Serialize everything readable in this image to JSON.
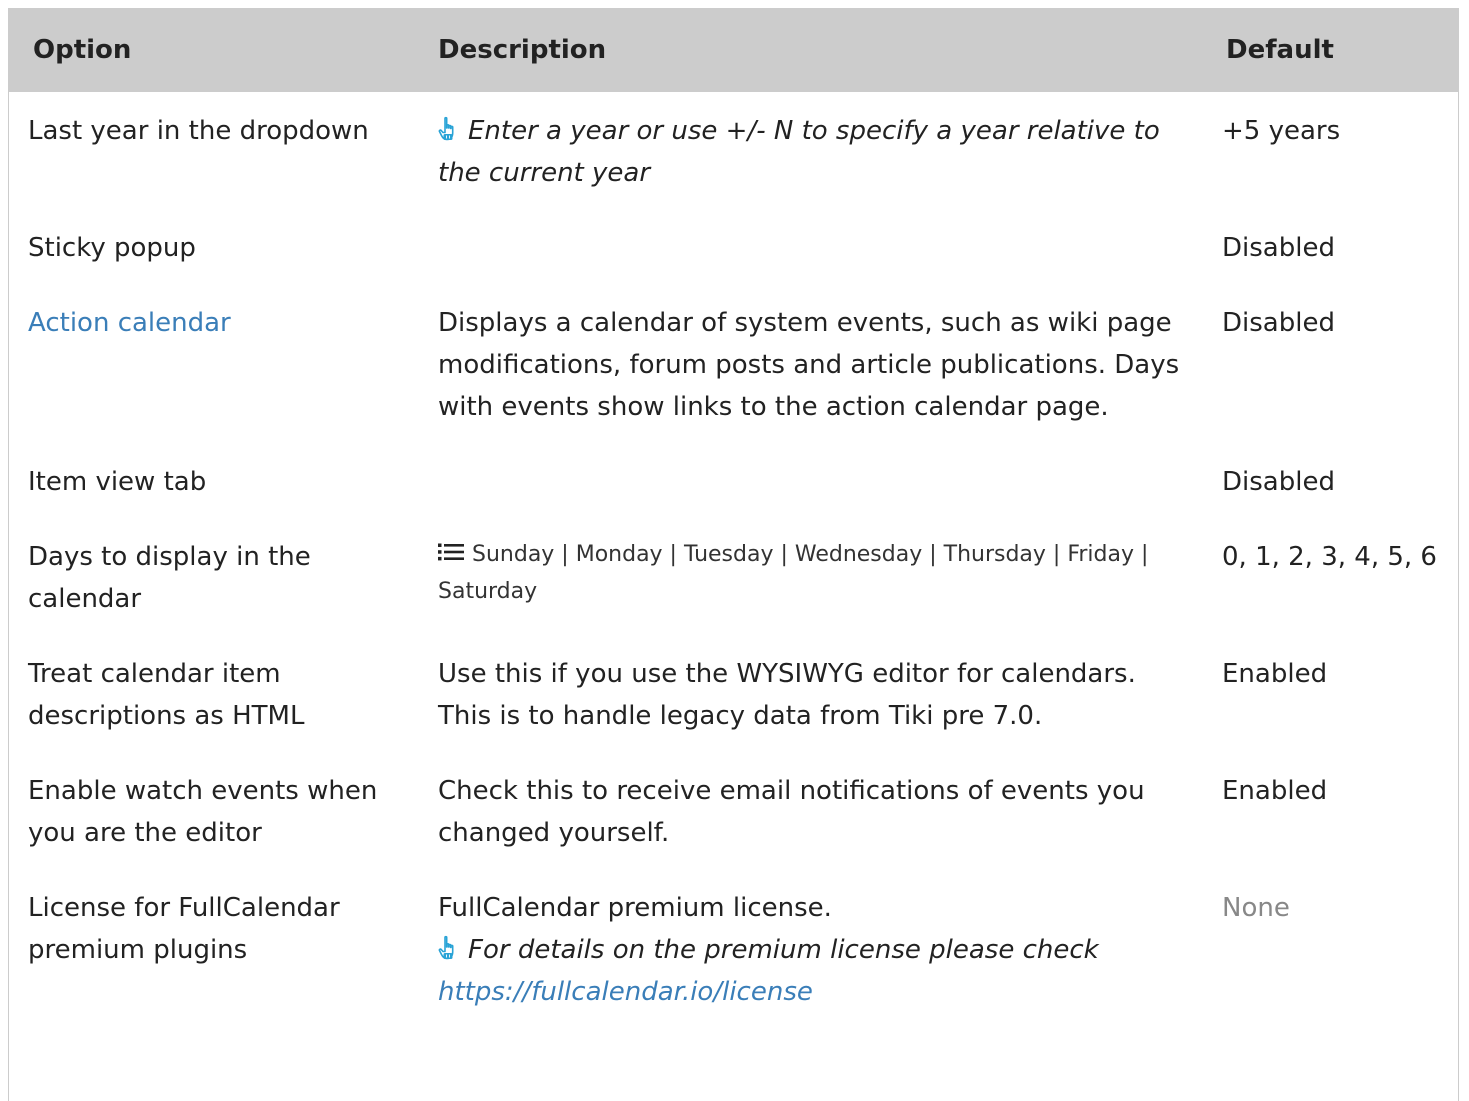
{
  "header": {
    "option": "Option",
    "description": "Description",
    "default": "Default"
  },
  "rows": [
    {
      "option": "Last year in the dropdown",
      "hint": "Enter a year or use +/- N to specify a year relative to the current year",
      "hint_icon": "pointing-hand-icon",
      "default": "+5 years"
    },
    {
      "option": "Sticky popup",
      "description": "",
      "default": "Disabled"
    },
    {
      "option": "Action calendar",
      "option_is_link": true,
      "description": "Displays a calendar of system events, such as wiki page modifications, forum posts and article publications. Days with events show links to the action calendar page.",
      "default": "Disabled"
    },
    {
      "option": "Item view tab",
      "description": "",
      "default": "Disabled"
    },
    {
      "option": "Days to display in the calendar",
      "list_icon": "list-icon",
      "description": "Sunday | Monday | Tuesday | Wednesday | Thursday | Friday | Saturday",
      "default": "0, 1, 2, 3, 4, 5, 6"
    },
    {
      "option": "Treat calendar item descriptions as HTML",
      "description": "Use this if you use the WYSIWYG editor for calendars. This is to handle legacy data from Tiki pre 7.0.",
      "default": "Enabled"
    },
    {
      "option": "Enable watch events when you are the editor",
      "description": "Check this to receive email notifications of events you changed yourself.",
      "default": "Enabled"
    },
    {
      "option": "License for FullCalendar premium plugins",
      "description": "FullCalendar premium license.",
      "hint": "For details on the premium license please check",
      "hint_icon": "pointing-hand-icon",
      "hint_link": "https://fullcalendar.io/license",
      "default": "None"
    }
  ],
  "colors": {
    "header_bg": "#cccccc",
    "link": "#3a7eb8",
    "muted": "#888888",
    "icon": "#29a3d6"
  }
}
